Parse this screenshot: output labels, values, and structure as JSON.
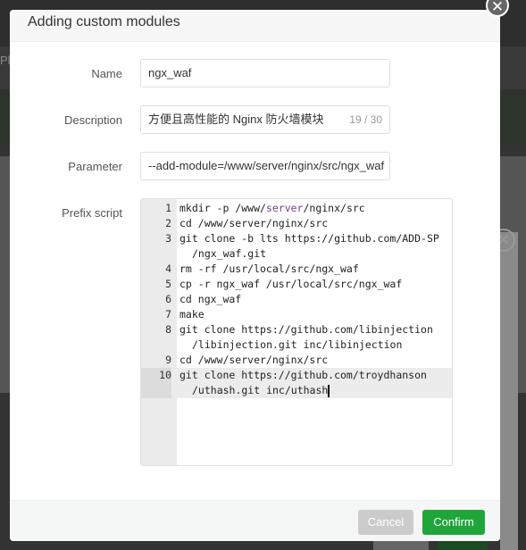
{
  "background": {
    "partial_text": "Plu"
  },
  "dialog": {
    "title": "Adding custom modules",
    "fields": {
      "name": {
        "label": "Name",
        "value": "ngx_waf"
      },
      "description": {
        "label": "Description",
        "value": "方便且高性能的 Nginx 防火墙模块",
        "counter": "19 / 30"
      },
      "parameter": {
        "label": "Parameter",
        "value": "--add-module=/www/server/nginx/src/ngx_waf"
      },
      "prefix_script": {
        "label": "Prefix script"
      }
    },
    "script_lines": [
      {
        "num": "1",
        "pre": "mkdir -p /www/",
        "kw": "server",
        "post": "/nginx/src"
      },
      {
        "num": "2",
        "text": "cd /www/server/nginx/src"
      },
      {
        "num": "3",
        "text": "git clone -b lts https://github.com/ADD-SP",
        "wrap": "/ngx_waf.git"
      },
      {
        "num": "4",
        "text": "rm -rf /usr/local/src/ngx_waf"
      },
      {
        "num": "5",
        "text": "cp -r ngx_waf /usr/local/src/ngx_waf"
      },
      {
        "num": "6",
        "text": "cd ngx_waf"
      },
      {
        "num": "7",
        "text": "make"
      },
      {
        "num": "8",
        "text": "git clone https://github.com/libinjection",
        "wrap": "/libinjection.git inc/libinjection"
      },
      {
        "num": "9",
        "text": "cd /www/server/nginx/src"
      },
      {
        "num": "10",
        "text": "git clone https://github.com/troydhanson",
        "wrap": "/uthash.git inc/uthash"
      }
    ],
    "buttons": {
      "cancel": "Cancel",
      "confirm": "Confirm"
    },
    "colors": {
      "confirm": "#20a53a",
      "cancel": "#cbcbcb"
    }
  }
}
